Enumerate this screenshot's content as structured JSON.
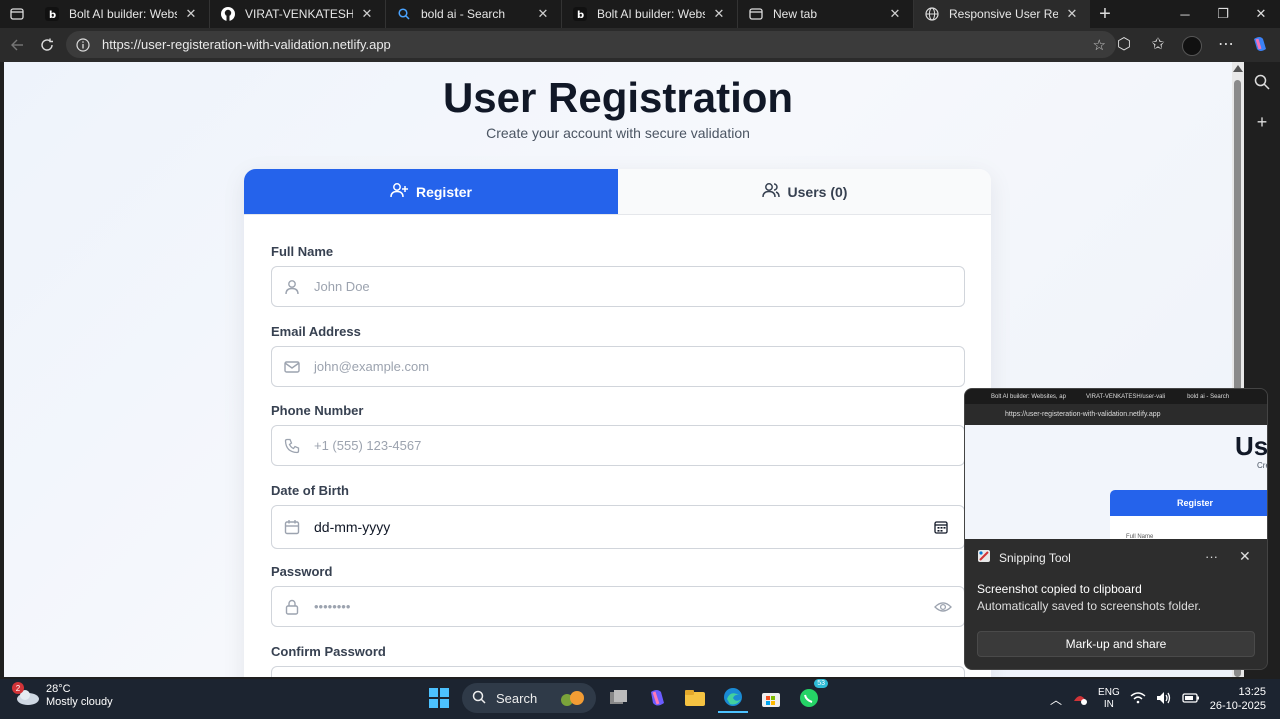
{
  "browser": {
    "tabs": [
      {
        "title": "Bolt AI builder: Websites, apps",
        "icon": "bolt-icon"
      },
      {
        "title": "VIRAT-VENKATESH/user-vali",
        "icon": "github-icon"
      },
      {
        "title": "bold ai - Search",
        "icon": "search-icon"
      },
      {
        "title": "Bolt AI builder: Websites, apps",
        "icon": "bolt-icon"
      },
      {
        "title": "New tab",
        "icon": "newtab-icon"
      },
      {
        "title": "Responsive User Registration",
        "icon": "globe-icon"
      }
    ],
    "url": "https://user-registeration-with-validation.netlify.app"
  },
  "page": {
    "title": "User Registration",
    "subtitle": "Create your account with secure validation",
    "tabs": {
      "register": "Register",
      "users": "Users (0)"
    },
    "fields": [
      {
        "label": "Full Name",
        "placeholder": "John Doe",
        "icon": "user-icon"
      },
      {
        "label": "Email Address",
        "placeholder": "john@example.com",
        "icon": "mail-icon"
      },
      {
        "label": "Phone Number",
        "placeholder": "+1 (555) 123-4567",
        "icon": "phone-icon"
      },
      {
        "label": "Date of Birth",
        "value": "dd-mm-yyyy",
        "icon": "calendar-icon"
      },
      {
        "label": "Password",
        "placeholder": "••••••••",
        "icon": "lock-icon"
      },
      {
        "label": "Confirm Password"
      }
    ]
  },
  "snip": {
    "mini_tabs": [
      "Bolt AI builder: Websites, ap",
      "VIRAT-VENKATESH/user-vali",
      "bold ai - Search"
    ],
    "mini_url": "https://user-registeration-with-validation.netlify.app",
    "mini_title": "Use",
    "mini_sub": "Cre",
    "mini_register": "Register",
    "mini_label": "Full Name",
    "app": "Snipping Tool",
    "msg1": "Screenshot copied to clipboard",
    "msg2": "Automatically saved to screenshots folder.",
    "button": "Mark-up and share"
  },
  "taskbar": {
    "weather_temp": "28°C",
    "weather_desc": "Mostly cloudy",
    "weather_badge": "2",
    "search": "Search",
    "whatsapp_badge": "53",
    "lang1": "ENG",
    "lang2": "IN",
    "time": "13:25",
    "date": "26-10-2025"
  }
}
